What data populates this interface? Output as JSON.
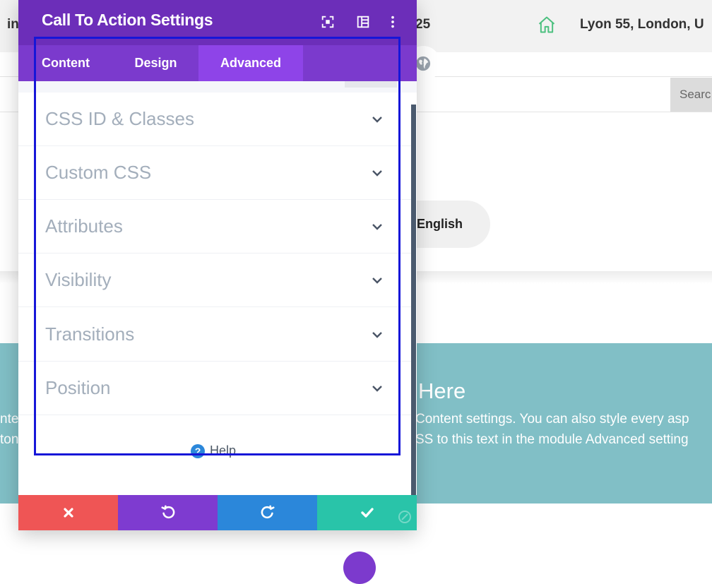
{
  "background": {
    "topbar": {
      "partial_left": "in",
      "partial_mid": "25",
      "address": "Lyon 55, London, U"
    },
    "search_partial": "Searc",
    "language": "English",
    "cta": {
      "heading_partial": "Here",
      "line1": "Content settings. You can also style every asp",
      "line2": "SS to this text in the module Advanced setting",
      "left_edge1": "nte",
      "left_edge2": "ton"
    }
  },
  "modal": {
    "title": "Call To Action Settings",
    "header_icons": [
      "expand-icon",
      "columns-icon",
      "more-icon"
    ],
    "tabs": [
      {
        "label": "Content",
        "active": false
      },
      {
        "label": "Design",
        "active": false
      },
      {
        "label": "Advanced",
        "active": true
      }
    ],
    "toggles": [
      {
        "label": "CSS ID & Classes"
      },
      {
        "label": "Custom CSS"
      },
      {
        "label": "Attributes"
      },
      {
        "label": "Visibility"
      },
      {
        "label": "Transitions"
      },
      {
        "label": "Position"
      }
    ],
    "help": {
      "icon_glyph": "?",
      "label": "Help"
    },
    "footer_icons": [
      "close-icon",
      "undo-icon",
      "redo-icon",
      "check-icon"
    ]
  },
  "colors": {
    "header": "#6c2eb9",
    "tabs": "#7b3acd",
    "active_tab": "#8e44e8",
    "discard": "#ef5555",
    "undo": "#7e3bd0",
    "redo": "#2b87da",
    "save": "#29c4a9",
    "teal": "#81bfc6",
    "focus": "#1616d8"
  }
}
